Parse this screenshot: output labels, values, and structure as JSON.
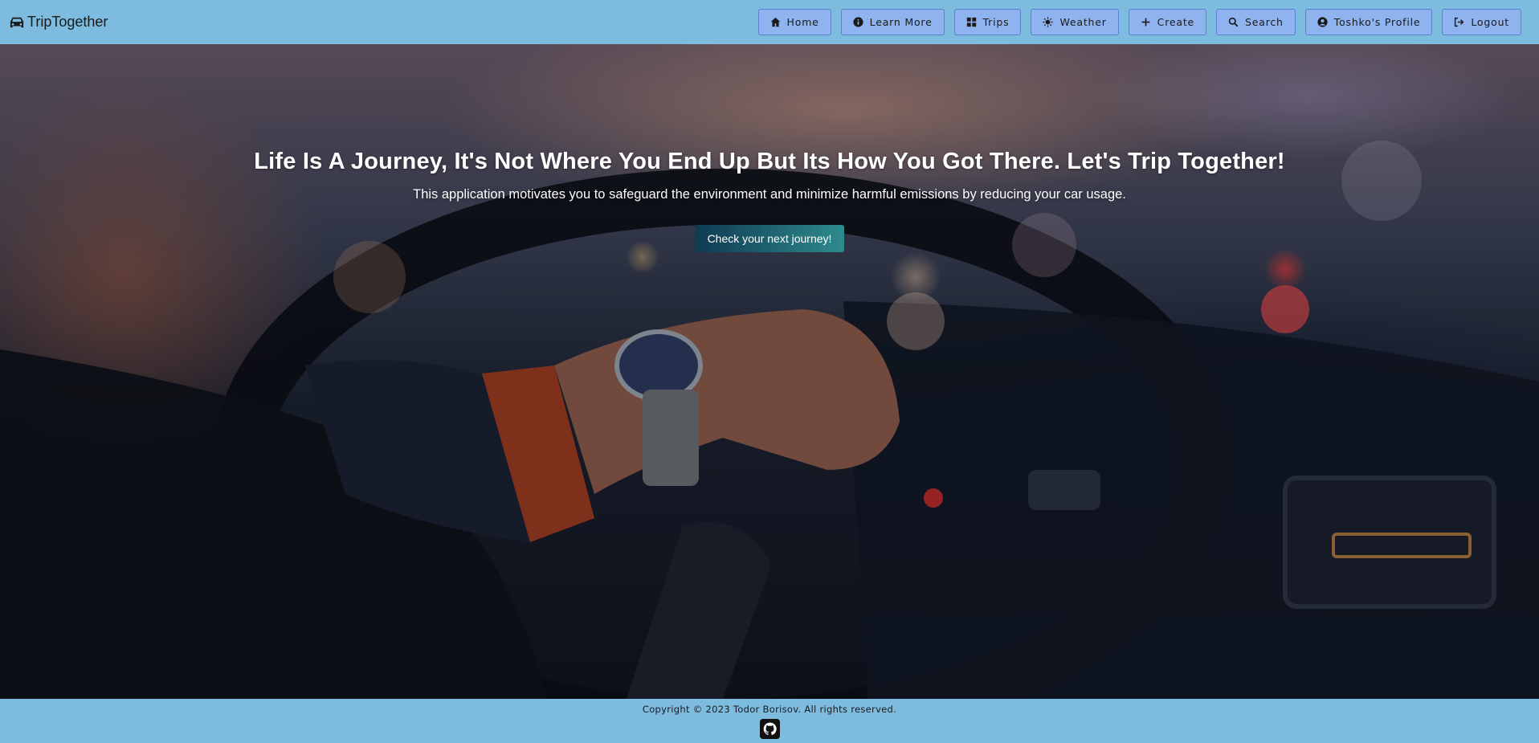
{
  "header": {
    "brand": {
      "icon": "car-icon",
      "label": "TripTogether"
    },
    "nav": [
      {
        "id": "home",
        "icon": "home-icon",
        "label": "Home"
      },
      {
        "id": "learn-more",
        "icon": "info-icon",
        "label": "Learn More"
      },
      {
        "id": "trips",
        "icon": "grid-icon",
        "label": "Trips"
      },
      {
        "id": "weather",
        "icon": "sun-icon",
        "label": "Weather"
      },
      {
        "id": "create",
        "icon": "plus-icon",
        "label": "Create"
      },
      {
        "id": "search",
        "icon": "search-icon",
        "label": "Search"
      },
      {
        "id": "profile",
        "icon": "user-icon",
        "label": "Toshko's Profile"
      },
      {
        "id": "logout",
        "icon": "logout-icon",
        "label": "Logout"
      }
    ]
  },
  "hero": {
    "title": "Life Is A Journey, It's Not Where You End Up But Its How You Got There. Let's Trip Together!",
    "subtitle": "This application motivates you to safeguard the environment and minimize harmful emissions by reducing your car usage.",
    "cta_label": "Check your next journey!"
  },
  "footer": {
    "copyright": "Copyright © 2023 Todor Borisov. All rights reserved.",
    "github_icon": "github-icon"
  },
  "colors": {
    "header_bg": "#7dbcdf",
    "nav_button_bg": "#8fb3ef",
    "nav_button_border": "#5b7fd1",
    "cta_gradient_start": "#0f3a52",
    "cta_gradient_end": "#2e8b8c"
  }
}
